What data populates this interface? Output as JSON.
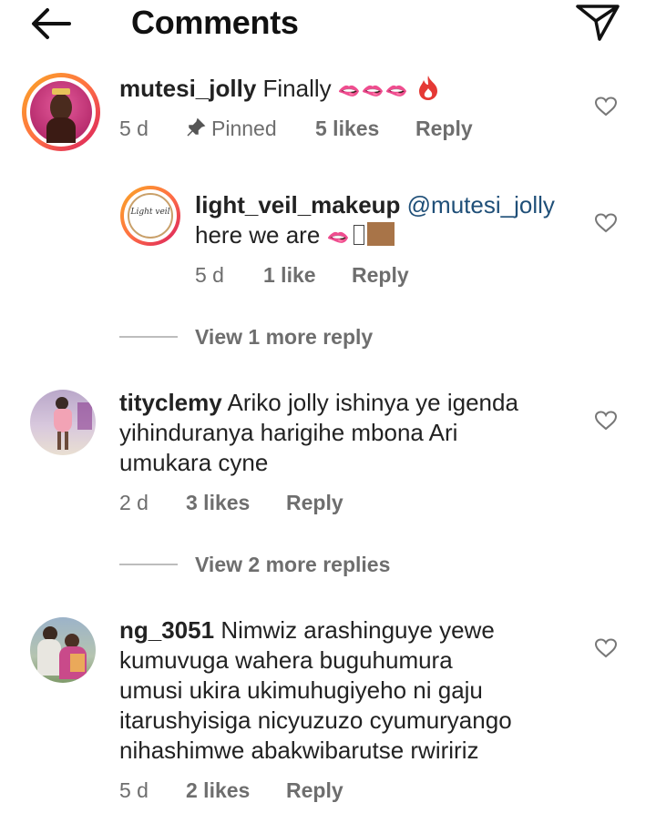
{
  "header": {
    "title": "Comments"
  },
  "comments": [
    {
      "username": "mutesi_jolly",
      "text": "Finally",
      "emoji": "🫦🫦🫦",
      "age": "5 d",
      "pinned_label": "Pinned",
      "likes": "5 likes",
      "reply_label": "Reply"
    },
    {
      "username": "light_veil_makeup",
      "mention": "@mutesi_jolly",
      "text": "here we are",
      "emoji": "🫦",
      "avatar_text": "Light veil",
      "age": "5 d",
      "likes": "1 like",
      "reply_label": "Reply"
    },
    {
      "username": "tityclemy",
      "text_lines": [
        "Ariko jolly ishinya ye igenda",
        "yihinduranya harigihe mbona Ari",
        "umukara cyne"
      ],
      "age": "2 d",
      "likes": "3 likes",
      "reply_label": "Reply"
    },
    {
      "username": "ng_3051",
      "text_lines": [
        "Nimwiz arashinguye yewe",
        "kumuvuga wahera buguhumura",
        "umusi ukira ukimuhugiyeho ni gaju",
        "itarushyisiga nicyuzuzo cyumuryango",
        "nihashimwe abakwibarutse rwiririz"
      ],
      "age": "5 d",
      "likes": "2 likes",
      "reply_label": "Reply"
    }
  ],
  "view_more": [
    "View 1 more reply",
    "View 2 more replies"
  ],
  "colors": {
    "mention": "#1f4f78",
    "meta": "#6e6e6e",
    "ring_start": "#f9a825",
    "ring_end": "#d81b60",
    "fire": "#e53935"
  }
}
